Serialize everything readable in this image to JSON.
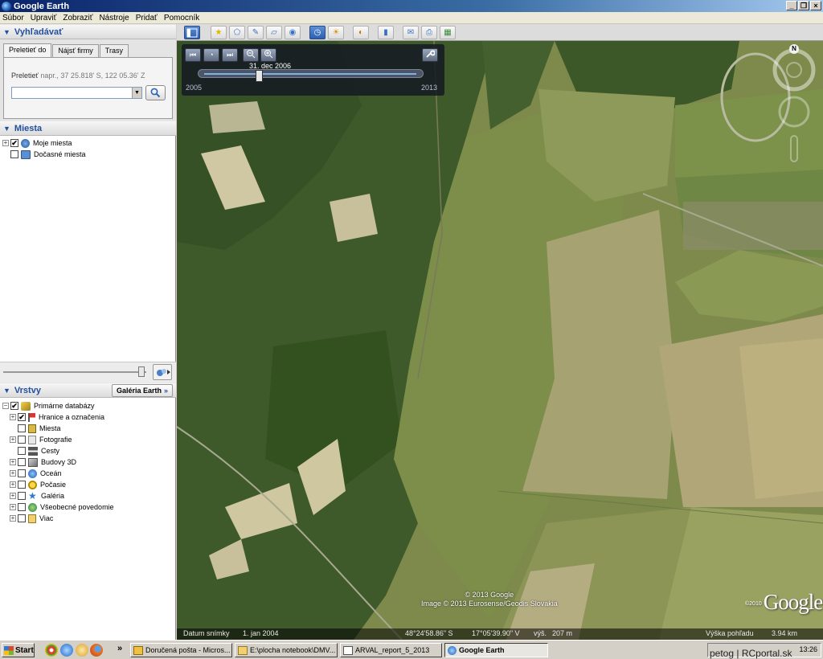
{
  "window": {
    "title": "Google Earth",
    "buttons": [
      "_",
      "❐",
      "×"
    ]
  },
  "menu": [
    "Súbor",
    "Upraviť",
    "Zobraziť",
    "Nástroje",
    "Pridať",
    "Pomocník"
  ],
  "search": {
    "header": "Vyhľadávať",
    "tabs": [
      "Preletieť do",
      "Nájsť firmy",
      "Trasy"
    ],
    "hint_label": "Preletieť",
    "hint_example": "napr., 37 25.818' S, 122 05.36' Z",
    "input_value": ""
  },
  "places": {
    "header": "Miesta",
    "items": [
      {
        "label": "Moje miesta",
        "checked": "✔"
      },
      {
        "label": "Dočasné miesta",
        "checked": ""
      }
    ]
  },
  "layers": {
    "header": "Vrstvy",
    "gallery_button": "Galéria Earth",
    "gallery_arrows": "»",
    "root": {
      "label": "Primárne databázy",
      "checked": "✔"
    },
    "items": [
      {
        "label": "Hranice a označenia",
        "checked": "✔"
      },
      {
        "label": "Miesta",
        "checked": ""
      },
      {
        "label": "Fotografie",
        "checked": ""
      },
      {
        "label": "Cesty",
        "checked": ""
      },
      {
        "label": "Budovy 3D",
        "checked": ""
      },
      {
        "label": "Oceán",
        "checked": ""
      },
      {
        "label": "Počasie",
        "checked": ""
      },
      {
        "label": "Galéria",
        "checked": ""
      },
      {
        "label": "Všeobecné povedomie",
        "checked": ""
      },
      {
        "label": "Viac",
        "checked": ""
      }
    ]
  },
  "timeslider": {
    "date": "31. dec 2006",
    "year_start": "2005",
    "year_end": "2013",
    "position": 0.26
  },
  "map": {
    "compass": "N",
    "copyright_1": "© 2013 Google",
    "copyright_2": "Image © 2013 Eurosense/Geodis Slovakia",
    "logo_year": "©2010",
    "logo": "Google",
    "status": {
      "date_label": "Datum snímky",
      "date_value": "1. jan 2004",
      "lat": "48°24'58.86\" S",
      "lon": "17°05'39.90\" V",
      "elev_label": "výš.",
      "elev_value": "207 m",
      "eye_label": "Výška pohľadu",
      "eye_value": "3.94 km"
    }
  },
  "taskbar": {
    "start": "Start",
    "quicklaunch_more": "»",
    "tasks": [
      "Doručená pošta - Micros...",
      "E:\\plocha notebook\\DMV...",
      "ARVAL_report_5_2013",
      "Google Earth"
    ],
    "tray_watermark": "petog | RCportal.sk",
    "clock": "13:26"
  },
  "colors": {
    "accent": "#1f4f9f",
    "titlebar": "#0a246a",
    "forest": "#3f5a2a",
    "field": "#9a9a5e"
  }
}
